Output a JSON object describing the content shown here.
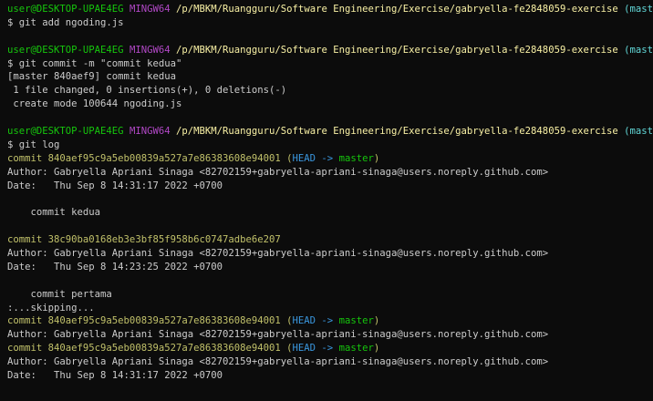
{
  "prompt": {
    "user": "user@DESKTOP-UPAE4EG",
    "shell": "MINGW64",
    "path": "/p/MBKM/Ruangguru/Software Engineering/Exercise/gabryella-fe2848059-exercise",
    "branch": "(master)"
  },
  "commands": {
    "add": "$ git add ngoding.js",
    "commit": "$ git commit -m \"commit kedua\"",
    "log": "$ git log"
  },
  "commit_output": [
    "[master 840aef9] commit kedua",
    " 1 file changed, 0 insertions(+), 0 deletions(-)",
    " create mode 100644 ngoding.js"
  ],
  "log": {
    "entry1": {
      "hash_label": "commit 840aef95c9a5eb00839a527a7e86383608e94001",
      "open_paren": " (",
      "head": "HEAD -> ",
      "branch": "master",
      "close_paren": ")",
      "author": "Author: Gabryella Apriani Sinaga <82702159+gabryella-apriani-sinaga@users.noreply.github.com>",
      "date": "Date:   Thu Sep 8 14:31:17 2022 +0700",
      "message": "    commit kedua"
    },
    "entry2": {
      "hash_label": "commit 38c90ba0168eb3e3bf85f958b6c0747adbe6e207",
      "author": "Author: Gabryella Apriani Sinaga <82702159+gabryella-apriani-sinaga@users.noreply.github.com>",
      "date": "Date:   Thu Sep 8 14:23:25 2022 +0700",
      "message": "    commit pertama"
    },
    "skipping": ":...skipping...",
    "entry3": {
      "hash_label": "commit 840aef95c9a5eb00839a527a7e86383608e94001",
      "open_paren": " (",
      "head": "HEAD -> ",
      "branch": "master",
      "close_paren": ")",
      "author": "Author: Gabryella Apriani Sinaga <82702159+gabryella-apriani-sinaga@users.noreply.github.com>"
    },
    "entry4": {
      "hash_label": "commit 840aef95c9a5eb00839a527a7e86383608e94001",
      "open_paren": " (",
      "head": "HEAD -> ",
      "branch": "master",
      "close_paren": ")",
      "author": "Author: Gabryella Apriani Sinaga <82702159+gabryella-apriani-sinaga@users.noreply.github.com>",
      "date": "Date:   Thu Sep 8 14:31:17 2022 +0700"
    }
  },
  "colors": {
    "background": "#0c0c0c",
    "user": "#16c60c",
    "shell": "#b148c6",
    "path": "#f9f1a5",
    "branch_prompt": "#61d6d6",
    "commit_hash": "#c1c16a",
    "head": "#3a96dd",
    "text": "#cccccc"
  }
}
